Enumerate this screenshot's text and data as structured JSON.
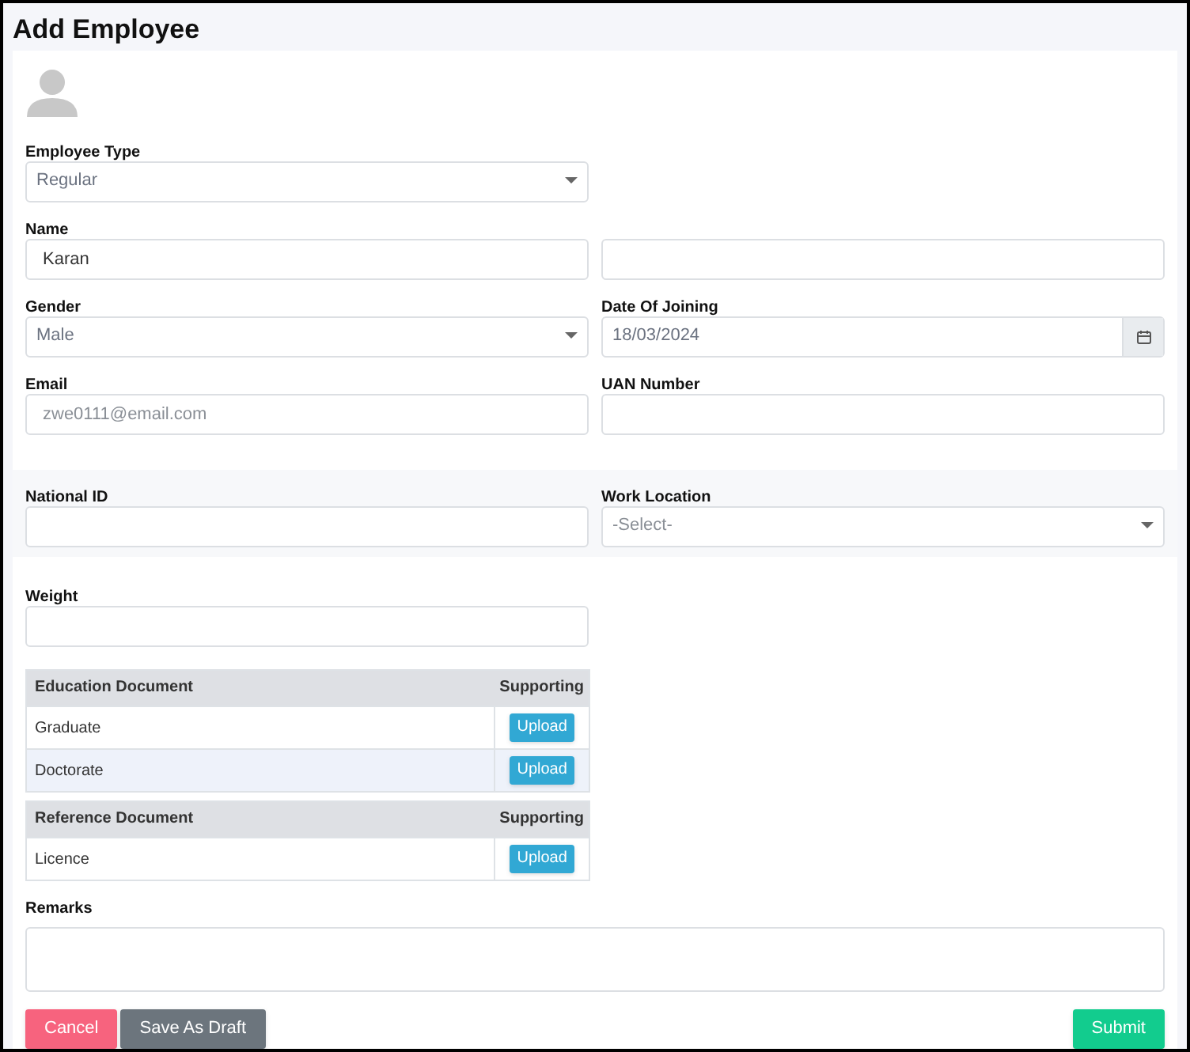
{
  "title": "Add Employee",
  "groups": [
    {
      "shaded": false,
      "rows": [
        [
          {
            "label": "Employee Type",
            "kind": "select",
            "value": "Regular"
          }
        ],
        [
          {
            "label": "Name",
            "kind": "text",
            "value": "Karan"
          },
          {
            "kind": "text"
          }
        ],
        [
          {
            "label": "Gender",
            "kind": "select",
            "value": "Male"
          },
          {
            "label": "Date Of Joining",
            "kind": "date",
            "value": "18/03/2024"
          }
        ],
        [
          {
            "label": "Email",
            "kind": "text",
            "placeholder": "zwe0111@email.com"
          },
          {
            "label": "UAN Number",
            "kind": "text"
          }
        ]
      ]
    },
    {
      "shaded": true,
      "rows": [
        [
          {
            "label": "National ID",
            "kind": "text"
          },
          {
            "label": "Work Location",
            "kind": "select",
            "placeholder": "-Select-"
          }
        ]
      ]
    },
    {
      "shaded": false,
      "rows": [
        [
          {
            "label": "Weight",
            "kind": "text"
          }
        ]
      ]
    }
  ],
  "tables": [
    {
      "columns": [
        "Education Document",
        "Supporting"
      ],
      "rows": [
        {
          "name": "Graduate",
          "action": "Upload"
        },
        {
          "name": "Doctorate",
          "action": "Upload"
        }
      ]
    },
    {
      "columns": [
        "Reference Document",
        "Supporting"
      ],
      "rows": [
        {
          "name": "Licence",
          "action": "Upload"
        }
      ]
    }
  ],
  "remarks": {
    "label": "Remarks"
  },
  "buttons": [
    {
      "label": "Cancel",
      "kind": "cancel"
    },
    {
      "label": "Save As Draft",
      "kind": "draft"
    },
    {
      "label": "Submit",
      "kind": "submit"
    }
  ]
}
